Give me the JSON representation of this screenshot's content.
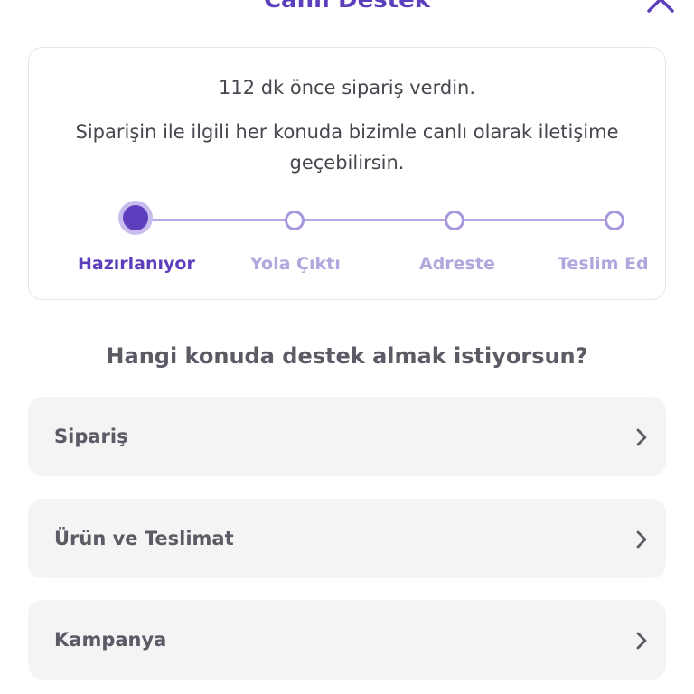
{
  "header": {
    "title": "Canlı Destek"
  },
  "order": {
    "time_text": "112 dk önce sipariş verdin.",
    "description": "Siparişin ile ilgili her konuda bizimle canlı olarak iletişime geçebilirsin.",
    "steps": [
      {
        "label": "Hazırlanıyor"
      },
      {
        "label": "Yola Çıktı"
      },
      {
        "label": "Adreste"
      },
      {
        "label": "Teslim Ed"
      }
    ]
  },
  "support": {
    "question": "Hangi konuda destek almak istiyorsun?",
    "topics": [
      {
        "label": "Sipariş"
      },
      {
        "label": "Ürün ve Teslimat"
      },
      {
        "label": "Kampanya"
      }
    ]
  },
  "colors": {
    "accent": "#5d3ebc",
    "step_inactive": "#b3a6dd",
    "card_bg": "#f4f4f5"
  },
  "icons": {
    "close": "close-icon",
    "chevron": "chevron-right-icon"
  }
}
